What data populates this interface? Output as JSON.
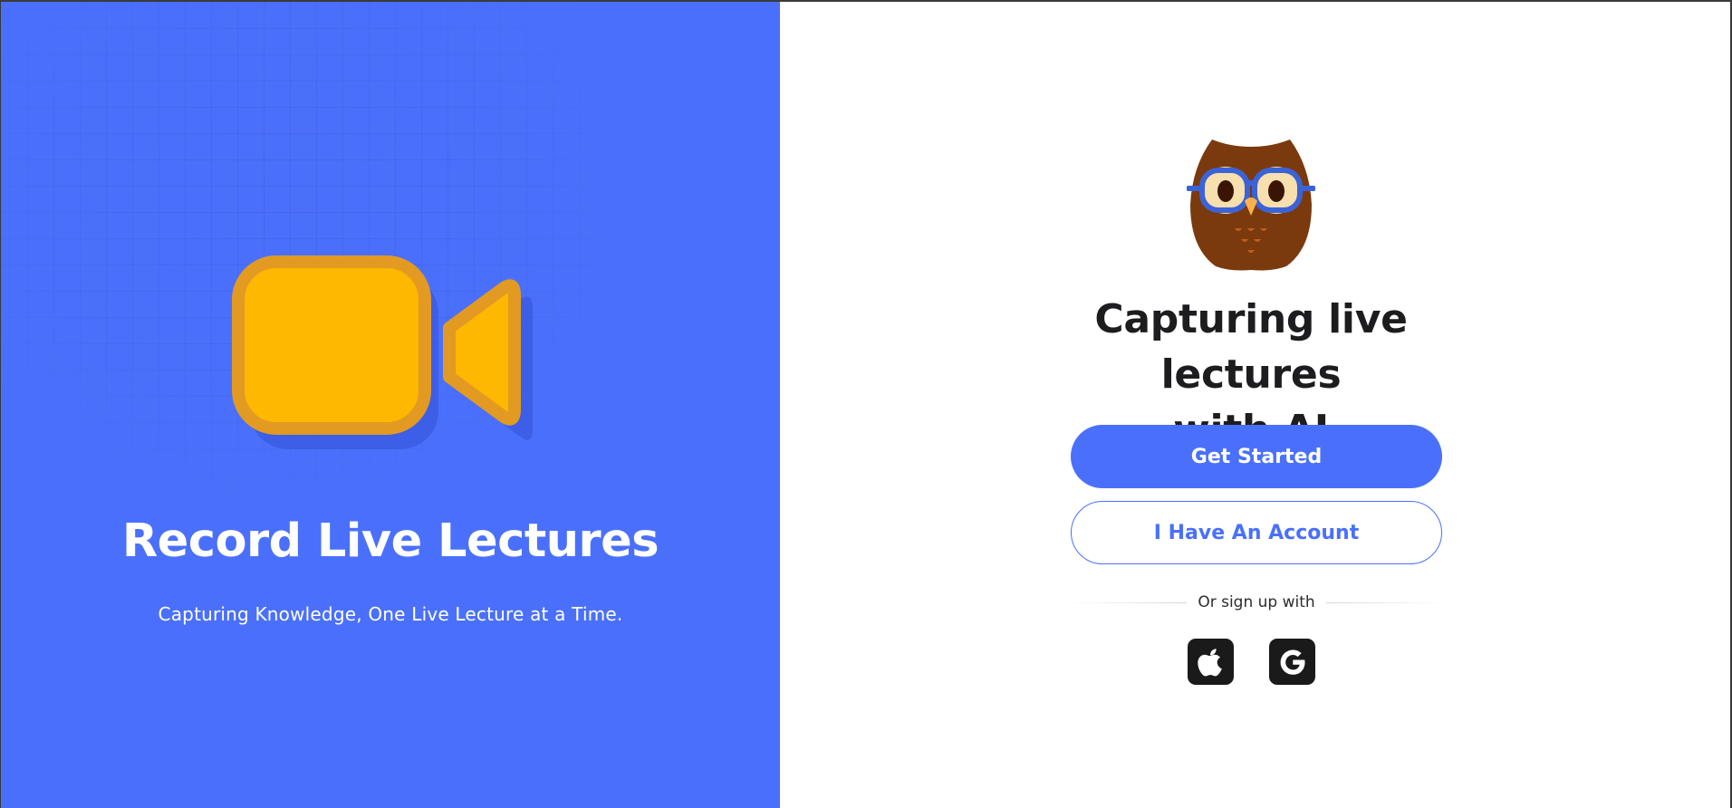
{
  "hero": {
    "title": "Record Live Lectures",
    "subtitle": "Capturing Knowledge, One Live Lecture at a Time.",
    "icon": "video-camera-icon"
  },
  "panel": {
    "mascot_icon": "owl-mascot-icon",
    "headline_line1": "Capturing live lectures",
    "headline_line2": "with AI",
    "primary_button": "Get Started",
    "secondary_button": "I Have An Account",
    "divider_text": "Or sign up with",
    "social": [
      {
        "name": "apple",
        "icon": "apple-icon"
      },
      {
        "name": "google",
        "icon": "google-icon"
      }
    ]
  },
  "colors": {
    "brand_blue": "#4a70fb",
    "camera_fill": "#ffb800",
    "camera_stroke": "#e29a22",
    "social_bg": "#1a1a1a"
  }
}
